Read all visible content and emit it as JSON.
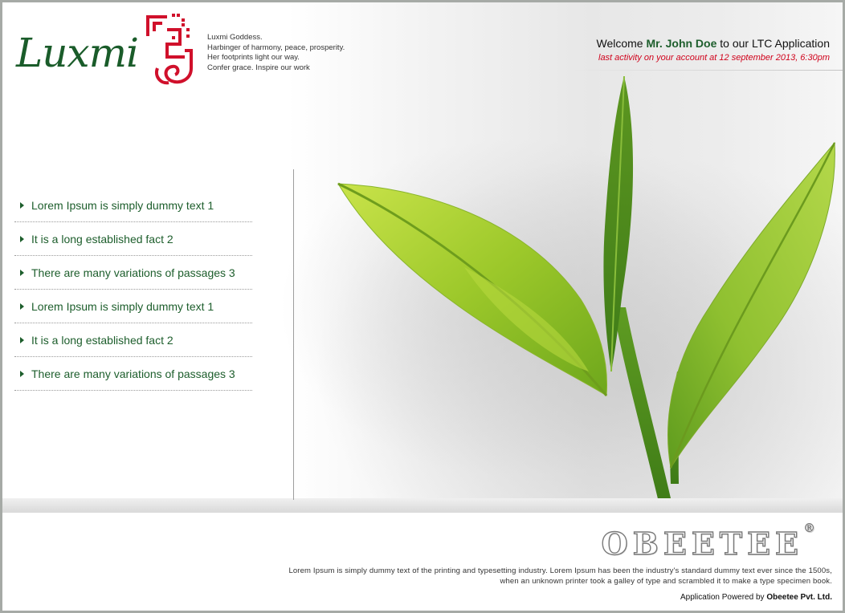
{
  "logo": {
    "name": "Luxmi"
  },
  "tagline": [
    "Luxmi Goddess.",
    "Harbinger of harmony, peace, prosperity.",
    "Her footprints light our way.",
    "Confer grace. Inspire our work"
  ],
  "welcome": {
    "prefix": "Welcome",
    "user": "Mr. John Doe",
    "suffix": "to our LTC Application",
    "activity": "last activity on your account at 12 september 2013, 6:30pm"
  },
  "menu": [
    {
      "label": "Lorem Ipsum is simply dummy text 1"
    },
    {
      "label": "It is a long established fact 2"
    },
    {
      "label": "There are many variations of passages 3"
    },
    {
      "label": "Lorem Ipsum is simply dummy text 1"
    },
    {
      "label": "It is a long established fact 2"
    },
    {
      "label": "There are many variations of passages 3"
    }
  ],
  "footer": {
    "brand": "OBEETEE",
    "registered": "®",
    "description_line1": "Lorem Ipsum is simply dummy text of the printing and typesetting industry. Lorem Ipsum has been the industry's standard dummy text ever since the 1500s,",
    "description_line2": "when an unknown printer took a galley of type and scrambled it to make a type specimen book.",
    "powered_prefix": "Application Powered by",
    "powered_company": "Obeetee Pvt. Ltd."
  },
  "colors": {
    "brand_green": "#1d5e2c",
    "accent_red": "#d0021b",
    "frame_gray": "#a6aaa6"
  }
}
